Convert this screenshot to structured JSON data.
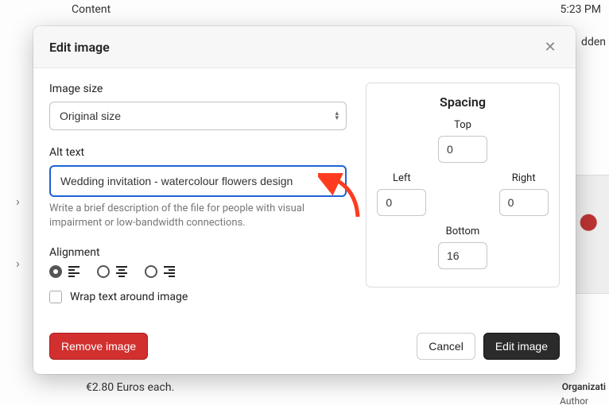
{
  "background": {
    "content_label": "Content",
    "time": "5:23 PM",
    "hidden_text": "dden",
    "price": "€2.80 Euros each.",
    "org_label": "Organizati",
    "author_label": "Author"
  },
  "modal": {
    "title": "Edit image",
    "image_size": {
      "label": "Image size",
      "value": "Original size"
    },
    "alt_text": {
      "label": "Alt text",
      "value": "Wedding invitation - watercolour flowers design",
      "help": "Write a brief description of the file for people with visual impairment or low-bandwidth connections."
    },
    "alignment": {
      "label": "Alignment",
      "wrap_label": "Wrap text around image"
    },
    "spacing": {
      "title": "Spacing",
      "top": {
        "label": "Top",
        "value": "0"
      },
      "left": {
        "label": "Left",
        "value": "0"
      },
      "right": {
        "label": "Right",
        "value": "0"
      },
      "bottom": {
        "label": "Bottom",
        "value": "16"
      }
    },
    "buttons": {
      "remove": "Remove image",
      "cancel": "Cancel",
      "save": "Edit image"
    }
  }
}
